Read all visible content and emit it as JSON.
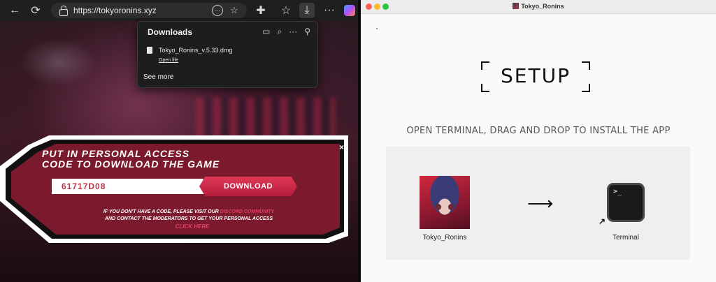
{
  "browser": {
    "url": "https://tokyoronins.xyz",
    "toolbar_icons": [
      "back-arrow-icon",
      "refresh-icon",
      "lock-icon",
      "more-icon",
      "star-icon",
      "extensions-icon",
      "favorites-icon",
      "download-icon",
      "copilot-icon"
    ]
  },
  "downloads_panel": {
    "title": "Downloads",
    "file_name": "Tokyo_Ronins_v.5.33.dmg",
    "open_file": "Open file",
    "see_more": "See more"
  },
  "banner": {
    "title_line1": "PUT IN PERSONAL ACCESS",
    "title_line2": "CODE TO DOWNLOAD THE GAME",
    "code_value": "61717D08",
    "download_label": "DOWNLOAD",
    "close": "×",
    "note_part1": "IF YOU DON'T HAVE A CODE, PLEASE VISIT OUR ",
    "note_link": "DISCORD COMMUNITY",
    "note_part2": "AND CONTACT THE MODERATORS TO GET YOUR PERSONAL ACCESS",
    "click_here": "CLICK HERE",
    "colors": {
      "accent": "#e03a58",
      "panel": "#7a1a2c"
    }
  },
  "installer": {
    "window_title": "Tokyo_Ronins",
    "heading": "SETUP",
    "instruction": "OPEN TERMINAL, DRAG AND DROP TO INSTALL THE APP",
    "app_label": "Tokyo_Ronins",
    "arrow": "⟶",
    "terminal_prompt": ">_",
    "terminal_label": "Terminal"
  }
}
